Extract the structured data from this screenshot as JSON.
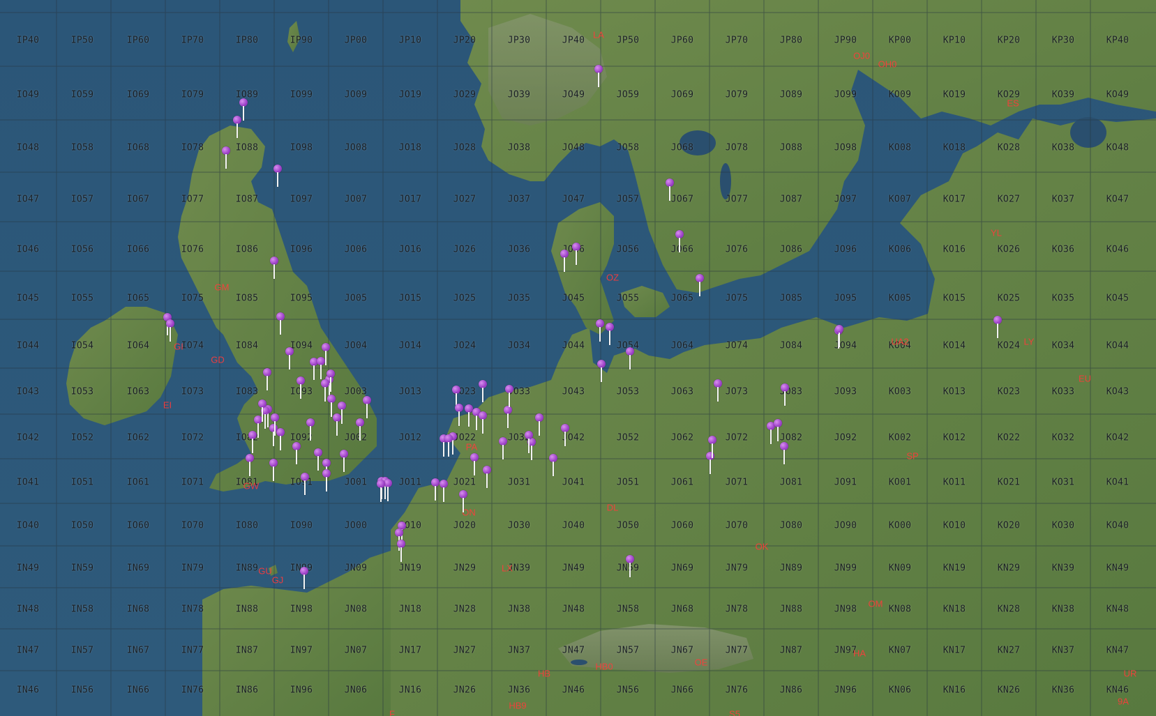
{
  "map": {
    "colors": {
      "sea": "#2d5778",
      "land": "#5e7d44",
      "land_dark": "#4a6a36",
      "grid_line": "#263540",
      "label_text": "#1a1f24",
      "prefix_text": "#ff3b3b",
      "marker_purple": "#a14fd0",
      "marker_green": "#1fbf3f"
    },
    "grid_rows": [
      [
        "IP40",
        "IP50",
        "IP60",
        "IP70",
        "IP80",
        "IP90",
        "JP00",
        "JP10",
        "JP20",
        "JP30",
        "JP40",
        "JP50",
        "JP60",
        "JP70",
        "JP80",
        "JP90",
        "KP00",
        "KP10",
        "KP20",
        "KP30",
        "KP40"
      ],
      [
        "IO49",
        "IO59",
        "IO69",
        "IO79",
        "IO89",
        "IO99",
        "JO09",
        "JO19",
        "JO29",
        "JO39",
        "JO49",
        "JO59",
        "JO69",
        "JO79",
        "JO89",
        "JO99",
        "KO09",
        "KO19",
        "KO29",
        "KO39",
        "KO49"
      ],
      [
        "IO48",
        "IO58",
        "IO68",
        "IO78",
        "IO88",
        "IO98",
        "JO08",
        "JO18",
        "JO28",
        "JO38",
        "JO48",
        "JO58",
        "JO68",
        "JO78",
        "JO88",
        "JO98",
        "KO08",
        "KO18",
        "KO28",
        "KO38",
        "KO48"
      ],
      [
        "IO47",
        "IO57",
        "IO67",
        "IO77",
        "IO87",
        "IO97",
        "JO07",
        "JO17",
        "JO27",
        "JO37",
        "JO47",
        "JO57",
        "JO67",
        "JO77",
        "JO87",
        "JO97",
        "KO07",
        "KO17",
        "KO27",
        "KO37",
        "KO47"
      ],
      [
        "IO46",
        "IO56",
        "IO66",
        "IO76",
        "IO86",
        "IO96",
        "JO06",
        "JO16",
        "JO26",
        "JO36",
        "JO46",
        "JO56",
        "JO66",
        "JO76",
        "JO86",
        "JO96",
        "KO06",
        "KO16",
        "KO26",
        "KO36",
        "KO46"
      ],
      [
        "IO45",
        "IO55",
        "IO65",
        "IO75",
        "IO85",
        "IO95",
        "JO05",
        "JO15",
        "JO25",
        "JO35",
        "JO45",
        "JO55",
        "JO65",
        "JO75",
        "JO85",
        "JO95",
        "KO05",
        "KO15",
        "KO25",
        "KO35",
        "KO45"
      ],
      [
        "IO44",
        "IO54",
        "IO64",
        "IO74",
        "IO84",
        "IO94",
        "JO04",
        "JO14",
        "JO24",
        "JO34",
        "JO44",
        "JO54",
        "JO64",
        "JO74",
        "JO84",
        "JO94",
        "KO04",
        "KO14",
        "KO24",
        "KO34",
        "KO44"
      ],
      [
        "IO43",
        "IO53",
        "IO63",
        "IO73",
        "IO83",
        "IO93",
        "JO03",
        "JO13",
        "JO23",
        "JO33",
        "JO43",
        "JO53",
        "JO63",
        "JO73",
        "JO83",
        "JO93",
        "KO03",
        "KO13",
        "KO23",
        "KO33",
        "KO43"
      ],
      [
        "IO42",
        "IO52",
        "IO62",
        "IO72",
        "IO82",
        "IO92",
        "JO02",
        "JO12",
        "JO22",
        "JO32",
        "JO42",
        "JO52",
        "JO62",
        "JO72",
        "JO82",
        "JO92",
        "KO02",
        "KO12",
        "KO22",
        "KO32",
        "KO42"
      ],
      [
        "IO41",
        "IO51",
        "IO61",
        "IO71",
        "IO81",
        "IO91",
        "JO01",
        "JO11",
        "JO21",
        "JO31",
        "JO41",
        "JO51",
        "JO61",
        "JO71",
        "JO81",
        "JO91",
        "KO01",
        "KO11",
        "KO21",
        "KO31",
        "KO41"
      ],
      [
        "IO40",
        "IO50",
        "IO60",
        "IO70",
        "IO80",
        "IO90",
        "JO00",
        "JO10",
        "JO20",
        "JO30",
        "JO40",
        "JO50",
        "JO60",
        "JO70",
        "JO80",
        "JO90",
        "KO00",
        "KO10",
        "KO20",
        "KO30",
        "KO40"
      ],
      [
        "IN49",
        "IN59",
        "IN69",
        "IN79",
        "IN89",
        "IN99",
        "JN09",
        "JN19",
        "JN29",
        "JN39",
        "JN49",
        "JN59",
        "JN69",
        "JN79",
        "JN89",
        "JN99",
        "KN09",
        "KN19",
        "KN29",
        "KN39",
        "KN49"
      ],
      [
        "IN48",
        "IN58",
        "IN68",
        "IN78",
        "IN88",
        "IN98",
        "JN08",
        "JN18",
        "JN28",
        "JN38",
        "JN48",
        "JN58",
        "JN68",
        "JN78",
        "JN88",
        "JN98",
        "KN08",
        "KN18",
        "KN28",
        "KN38",
        "KN48"
      ],
      [
        "IN47",
        "IN57",
        "IN67",
        "IN77",
        "IN87",
        "IN97",
        "JN07",
        "JN17",
        "JN27",
        "JN37",
        "JN47",
        "JN57",
        "JN67",
        "JN77",
        "JN87",
        "JN97",
        "KN07",
        "KN17",
        "KN27",
        "KN37",
        "KN47"
      ],
      [
        "IN46",
        "IN56",
        "IN66",
        "IN76",
        "IN86",
        "IN96",
        "JN06",
        "JN16",
        "JN26",
        "JN36",
        "JN46",
        "JN56",
        "JN66",
        "JN76",
        "JN86",
        "JN96",
        "KN06",
        "KN16",
        "KN26",
        "KN36",
        "KN46"
      ]
    ],
    "country_prefixes": [
      "LA",
      "OJ0",
      "OH0",
      "ES",
      "YL",
      "OZ",
      "GM",
      "GI",
      "GD",
      "EI",
      "LY",
      "UA2",
      "EU",
      "PA",
      "SP",
      "GW",
      "ON",
      "DL",
      "OK",
      "F",
      "GU",
      "GJ",
      "LX",
      "OM",
      "HB",
      "HB0",
      "OE",
      "HA",
      "UR",
      "S5",
      "9A",
      "HB9"
    ],
    "markers": [
      {
        "type": "station",
        "color": "purple"
      },
      {
        "type": "station",
        "color": "purple"
      },
      {
        "type": "station",
        "color": "purple"
      },
      {
        "type": "station",
        "color": "purple"
      },
      {
        "type": "station",
        "color": "purple"
      },
      {
        "type": "station",
        "color": "purple"
      },
      {
        "type": "station",
        "color": "purple"
      },
      {
        "type": "station",
        "color": "purple"
      },
      {
        "type": "station",
        "color": "purple"
      },
      {
        "type": "station",
        "color": "purple"
      },
      {
        "type": "station",
        "color": "purple"
      },
      {
        "type": "station",
        "color": "purple"
      },
      {
        "type": "station",
        "color": "purple"
      },
      {
        "type": "station",
        "color": "purple"
      },
      {
        "type": "station",
        "color": "purple"
      },
      {
        "type": "station",
        "color": "purple"
      },
      {
        "type": "station",
        "color": "purple"
      },
      {
        "type": "station",
        "color": "purple"
      },
      {
        "type": "station",
        "color": "purple"
      },
      {
        "type": "station",
        "color": "purple"
      },
      {
        "type": "station",
        "color": "purple"
      },
      {
        "type": "station",
        "color": "purple"
      },
      {
        "type": "station",
        "color": "purple"
      },
      {
        "type": "station",
        "color": "purple"
      },
      {
        "type": "station",
        "color": "purple"
      },
      {
        "type": "station",
        "color": "purple"
      },
      {
        "type": "station",
        "color": "purple"
      },
      {
        "type": "station",
        "color": "purple"
      },
      {
        "type": "station",
        "color": "purple"
      },
      {
        "type": "station",
        "color": "purple"
      },
      {
        "type": "station",
        "color": "purple"
      },
      {
        "type": "station",
        "color": "purple"
      },
      {
        "type": "station",
        "color": "purple"
      },
      {
        "type": "station",
        "color": "purple"
      },
      {
        "type": "station",
        "color": "purple"
      },
      {
        "type": "station",
        "color": "purple"
      },
      {
        "type": "station",
        "color": "purple"
      },
      {
        "type": "station",
        "color": "purple"
      },
      {
        "type": "station",
        "color": "purple"
      },
      {
        "type": "station",
        "color": "purple"
      },
      {
        "type": "station",
        "color": "purple"
      },
      {
        "type": "station",
        "color": "purple"
      },
      {
        "type": "station",
        "color": "purple"
      },
      {
        "type": "station",
        "color": "purple"
      },
      {
        "type": "station",
        "color": "purple"
      },
      {
        "type": "station",
        "color": "purple"
      },
      {
        "type": "station",
        "color": "purple"
      },
      {
        "type": "station",
        "color": "purple"
      },
      {
        "type": "station",
        "color": "purple"
      },
      {
        "type": "station",
        "color": "purple"
      },
      {
        "type": "station",
        "color": "purple"
      },
      {
        "type": "station",
        "color": "purple"
      },
      {
        "type": "station",
        "color": "purple"
      },
      {
        "type": "station",
        "color": "purple"
      },
      {
        "type": "station",
        "color": "purple"
      },
      {
        "type": "station",
        "color": "purple"
      },
      {
        "type": "station",
        "color": "purple"
      },
      {
        "type": "station",
        "color": "purple"
      },
      {
        "type": "station",
        "color": "purple"
      },
      {
        "type": "station",
        "color": "purple"
      },
      {
        "type": "station",
        "color": "purple"
      },
      {
        "type": "station",
        "color": "purple"
      },
      {
        "type": "station",
        "color": "purple"
      },
      {
        "type": "station",
        "color": "purple"
      },
      {
        "type": "station",
        "color": "purple"
      },
      {
        "type": "station",
        "color": "purple"
      },
      {
        "type": "station",
        "color": "purple"
      },
      {
        "type": "station",
        "color": "purple"
      },
      {
        "type": "station",
        "color": "purple"
      },
      {
        "type": "station",
        "color": "purple"
      },
      {
        "type": "station",
        "color": "purple"
      },
      {
        "type": "station",
        "color": "purple"
      },
      {
        "type": "station",
        "color": "purple"
      },
      {
        "type": "station",
        "color": "purple"
      },
      {
        "type": "station",
        "color": "purple"
      },
      {
        "type": "station",
        "color": "purple"
      },
      {
        "type": "station",
        "color": "purple"
      },
      {
        "type": "station",
        "color": "purple"
      },
      {
        "type": "station",
        "color": "purple"
      },
      {
        "type": "station",
        "color": "purple"
      },
      {
        "type": "station",
        "color": "purple"
      },
      {
        "type": "station",
        "color": "purple"
      },
      {
        "type": "station",
        "color": "purple"
      },
      {
        "type": "station",
        "color": "purple"
      },
      {
        "type": "station",
        "color": "purple"
      },
      {
        "type": "station",
        "color": "purple"
      },
      {
        "type": "station",
        "color": "purple"
      },
      {
        "type": "station",
        "color": "purple"
      },
      {
        "type": "station",
        "color": "purple"
      },
      {
        "type": "station",
        "color": "purple"
      },
      {
        "type": "station",
        "color": "purple"
      },
      {
        "type": "home",
        "color": "green"
      }
    ]
  }
}
